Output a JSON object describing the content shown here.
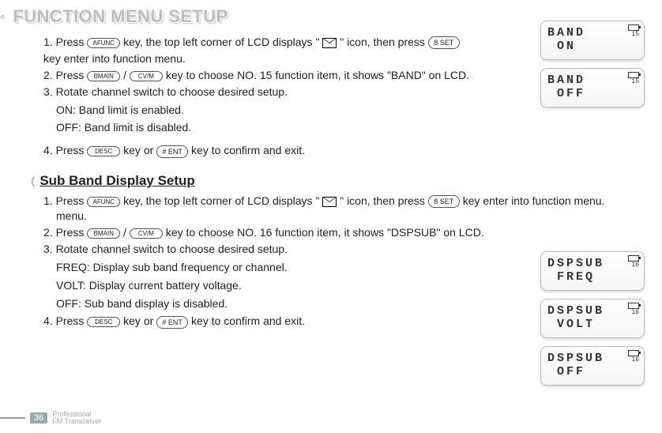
{
  "page_title": "FUNCTION MENU SETUP",
  "band": {
    "step1_a": "1. Press ",
    "step1_b": " key, the top left corner of LCD displays \"",
    "step1_c": "\" icon, then press ",
    "step1_d": " key enter into function menu.",
    "step2_a": "2. Press ",
    "step2_slash": " / ",
    "step2_b": " key to choose NO. 15 function item, it shows \"BAND\" on LCD.",
    "step3": "3. Rotate channel switch to choose desired setup.",
    "opt_on": "ON: Band limit is enabled.",
    "opt_off": "OFF: Band limit is disabled.",
    "step4_a": "4. Press ",
    "step4_b": " key or ",
    "step4_c": " key to confirm and exit."
  },
  "sub_title": "Sub Band Display Setup",
  "sub": {
    "step1_a": "1. Press ",
    "step1_b": " key, the top left corner of LCD displays \"",
    "step1_c": "\" icon, then press ",
    "step1_d": " key enter into function menu.",
    "step2_a": "2. Press ",
    "step2_slash": " / ",
    "step2_b": " key to choose NO. 16 function item, it shows \"DSPSUB\" on LCD.",
    "step3": "3. Rotate channel switch to choose desired setup.",
    "opt_freq": "FREQ: Display sub band frequency or channel.",
    "opt_volt": "VOLT: Display current battery voltage.",
    "opt_off": "OFF: Sub band display is disabled.",
    "step4_a": "4. Press ",
    "step4_b": " key or ",
    "step4_c": " key to confirm and exit."
  },
  "keys": {
    "a_func_top": "A",
    "a_func_bot": "FUNC",
    "b_main_top": "B",
    "b_main_bot": "MAIN",
    "c_vm_top": "C",
    "c_vm_bot": "V/M",
    "d_esc_top": "D",
    "d_esc_bot": "ESC",
    "eight_set": "8 SET",
    "hash_ent": "# ENT"
  },
  "lcd": {
    "band_on_l1": "BAND",
    "band_on_l2": "ON",
    "band_off_l1": "BAND",
    "band_off_l2": "OFF",
    "num15": "15",
    "dsp_freq_l1": "DSPSUB",
    "dsp_freq_l2": "FREQ",
    "dsp_volt_l1": "DSPSUB",
    "dsp_volt_l2": "VOLT",
    "dsp_off_l1": "DSPSUB",
    "dsp_off_l2": "OFF",
    "num16": "16"
  },
  "footer": {
    "page": "36",
    "line1": "Professional",
    "line2": "FM Transceiver"
  }
}
